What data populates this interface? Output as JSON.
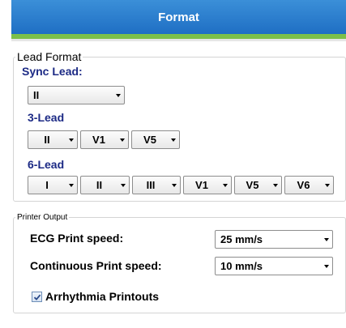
{
  "header": {
    "title": "Format"
  },
  "lead_format": {
    "legend": "Lead Format",
    "sync_lead": {
      "label": "Sync Lead:",
      "value": "II"
    },
    "three_lead": {
      "label": "3-Lead",
      "values": [
        "II",
        "V1",
        "V5"
      ]
    },
    "six_lead": {
      "label": "6-Lead",
      "values": [
        "I",
        "II",
        "III",
        "V1",
        "V5",
        "V6"
      ]
    }
  },
  "printer_output": {
    "legend": "Printer Output",
    "ecg_print_speed": {
      "label": "ECG Print speed:",
      "value": "25 mm/s"
    },
    "continuous_print_speed": {
      "label": "Continuous Print speed:",
      "value": "10 mm/s"
    },
    "arrhythmia_printouts": {
      "label": "Arrhythmia Printouts",
      "checked": true
    }
  },
  "colors": {
    "title_bar": "#1f6fc4",
    "accent": "#7cc04a",
    "label_blue": "#1c2a85"
  }
}
